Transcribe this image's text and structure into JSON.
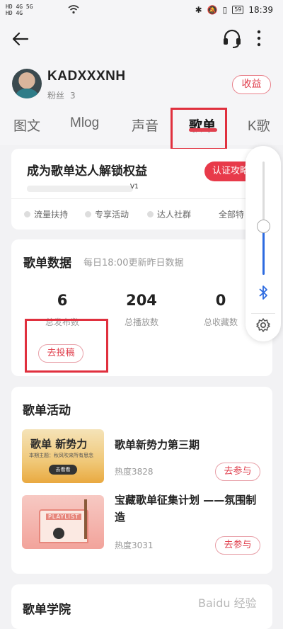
{
  "status_bar": {
    "left_line1": "HD 4G 5G",
    "left_line2": "HD 4G",
    "battery": "59",
    "time": "18:39"
  },
  "profile": {
    "username": "KADXXXNH",
    "fans_label": "粉丝",
    "fans_count": "3",
    "income_button": "收益"
  },
  "tabs": [
    {
      "label": "图文",
      "active": false
    },
    {
      "label": "Mlog",
      "active": false
    },
    {
      "label": "声音",
      "active": false
    },
    {
      "label": "歌单",
      "active": true
    },
    {
      "label": "K歌",
      "active": false
    }
  ],
  "expert_card": {
    "title": "成为歌单达人解锁权益",
    "certify_button": "认证攻略",
    "level": "V1",
    "features": [
      "流量扶持",
      "专享活动",
      "达人社群",
      "全部特"
    ]
  },
  "data_card": {
    "title": "歌单数据",
    "subtitle": "每日18:00更新昨日数据",
    "stats": [
      {
        "value": "6",
        "label": "总发布数"
      },
      {
        "value": "204",
        "label": "总播放数"
      },
      {
        "value": "0",
        "label": "总收藏数"
      }
    ],
    "submit_button": "去投稿"
  },
  "activities_card": {
    "title": "歌单活动",
    "items": [
      {
        "title": "歌单新势力第三期",
        "heat": "热度3828",
        "join": "去参与",
        "thumb_text": "歌单 新势力",
        "thumb_sub": "本期主题：秋风吹来所有思念",
        "thumb_btn": "去看看"
      },
      {
        "title": "宝藏歌单征集计划 ——氛围制造",
        "heat": "热度3031",
        "join": "去参与",
        "thumb_text": "PLAYLIST"
      }
    ]
  },
  "academy_card": {
    "title": "歌单学院"
  },
  "watermark": "Baidu 经验"
}
